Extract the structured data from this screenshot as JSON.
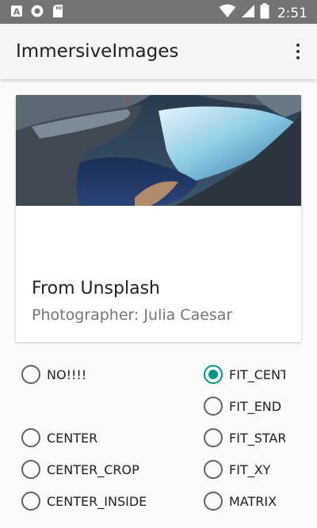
{
  "status_bar": {
    "time": "2:51",
    "icons": [
      "keyboard-icon",
      "circle-icon",
      "sd-card-icon",
      "wifi-icon",
      "signal-icon",
      "battery-icon"
    ]
  },
  "app_bar": {
    "title": "ImmersiveImages",
    "overflow_icon": "more-vert-icon"
  },
  "card": {
    "title": "From Unsplash",
    "subtitle": "Photographer: Julia Caesar"
  },
  "scale_options": {
    "selected": "FIT_CENTER",
    "left": [
      {
        "label": "NO!!!!",
        "checked": false
      },
      {
        "label": "CENTER",
        "checked": false
      },
      {
        "label": "CENTER_CROP",
        "checked": false
      },
      {
        "label": "CENTER_INSIDE",
        "checked": false
      }
    ],
    "right": [
      {
        "label": "FIT_CENTER",
        "checked": true
      },
      {
        "label": "FIT_END",
        "checked": false
      },
      {
        "label": "FIT_START",
        "checked": false
      },
      {
        "label": "FIT_XY",
        "checked": false
      },
      {
        "label": "MATRIX",
        "checked": false
      }
    ]
  },
  "colors": {
    "accent": "#009688",
    "status_bar": "#737373",
    "app_bar": "#f5f5f5"
  }
}
